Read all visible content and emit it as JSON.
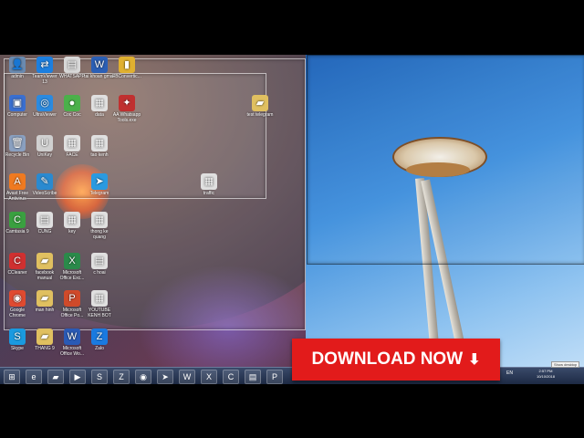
{
  "desktop": {
    "icons": [
      {
        "label": "admin",
        "glyph": "👤",
        "color": "#6a8ab0"
      },
      {
        "label": "TeamViewer 13",
        "glyph": "⇄",
        "color": "#1c7fe0"
      },
      {
        "label": "WHATSAPP",
        "glyph": "▤",
        "color": "#d8d8d8"
      },
      {
        "label": "tai khoan gmail",
        "glyph": "W",
        "color": "#2b5fb5"
      },
      {
        "label": "FBConvertic...",
        "glyph": "▮",
        "color": "#e0b030"
      },
      {
        "label": "Computer",
        "glyph": "▣",
        "color": "#3a6fd0"
      },
      {
        "label": "UltraViewer",
        "glyph": "◎",
        "color": "#2a8ae0"
      },
      {
        "label": "Coc Coc",
        "glyph": "●",
        "color": "#4bb04a"
      },
      {
        "label": "data",
        "glyph": "▦",
        "color": "#e0e0e0"
      },
      {
        "label": "AA Whatsapp Tools.exe",
        "glyph": "✦",
        "color": "#c03030"
      },
      {
        "label": "test telegram",
        "glyph": "▰",
        "color": "#e0c060"
      },
      {
        "label": "Recycle Bin",
        "glyph": "🗑",
        "color": "#8aa0c0"
      },
      {
        "label": "UniKey",
        "glyph": "U",
        "color": "#d0d0d0"
      },
      {
        "label": "FACE",
        "glyph": "▦",
        "color": "#e0e0e0"
      },
      {
        "label": "tao kenh",
        "glyph": "▦",
        "color": "#e0e0e0"
      },
      {
        "label": "Avast Free Antivirus",
        "glyph": "A",
        "color": "#f07a20"
      },
      {
        "label": "VideoScribe",
        "glyph": "✎",
        "color": "#2a8ad0"
      },
      {
        "label": "Telegram",
        "glyph": "➤",
        "color": "#2a9ae0"
      },
      {
        "label": "traffic",
        "glyph": "▦",
        "color": "#e0e0e0"
      },
      {
        "label": "Camtasia 9",
        "glyph": "C",
        "color": "#3aa040"
      },
      {
        "label": "CUNG",
        "glyph": "▤",
        "color": "#e0e0e0"
      },
      {
        "label": "key",
        "glyph": "▦",
        "color": "#e0e0e0"
      },
      {
        "label": "thong ke quang",
        "glyph": "▦",
        "color": "#e0e0e0"
      },
      {
        "label": "CCleaner",
        "glyph": "C",
        "color": "#d03030"
      },
      {
        "label": "facebook manual",
        "glyph": "▰",
        "color": "#e0c060"
      },
      {
        "label": "Microsoft Office Exc...",
        "glyph": "X",
        "color": "#2a8a4a"
      },
      {
        "label": "c hoai",
        "glyph": "▤",
        "color": "#e0e0e0"
      },
      {
        "label": "Google Chrome",
        "glyph": "◉",
        "color": "#e04a30"
      },
      {
        "label": "man hinh",
        "glyph": "▰",
        "color": "#e0c060"
      },
      {
        "label": "Microsoft Office Po...",
        "glyph": "P",
        "color": "#d04a2a"
      },
      {
        "label": "YOUTUBE KENH BOT",
        "glyph": "▦",
        "color": "#e0e0e0"
      },
      {
        "label": "Skype",
        "glyph": "S",
        "color": "#1a9ae0"
      },
      {
        "label": "THANG 9",
        "glyph": "▰",
        "color": "#e0c060"
      },
      {
        "label": "Microsoft Office Wo...",
        "glyph": "W",
        "color": "#2a5ab5"
      },
      {
        "label": "Zalo",
        "glyph": "Z",
        "color": "#1a7ae0"
      }
    ]
  },
  "taskbar": {
    "buttons": [
      {
        "name": "start-button",
        "glyph": "⊞"
      },
      {
        "name": "ie-icon",
        "glyph": "e"
      },
      {
        "name": "explorer-icon",
        "glyph": "▰"
      },
      {
        "name": "media-player-icon",
        "glyph": "▶"
      },
      {
        "name": "skype-icon",
        "glyph": "S"
      },
      {
        "name": "zalo-icon",
        "glyph": "Z"
      },
      {
        "name": "chrome-icon",
        "glyph": "◉"
      },
      {
        "name": "telegram-icon",
        "glyph": "➤"
      },
      {
        "name": "word-icon",
        "glyph": "W"
      },
      {
        "name": "excel-icon",
        "glyph": "X"
      },
      {
        "name": "camtasia-icon",
        "glyph": "C"
      },
      {
        "name": "file-icon",
        "glyph": "▤"
      },
      {
        "name": "powerpoint-icon",
        "glyph": "P"
      }
    ],
    "language": "EN",
    "time": "2:57 PM",
    "date": "10/10/2018",
    "show_desktop_tip": "Show desktop"
  },
  "banner": {
    "label": "DOWNLOAD NOW",
    "arrow_glyph": "⬇"
  }
}
